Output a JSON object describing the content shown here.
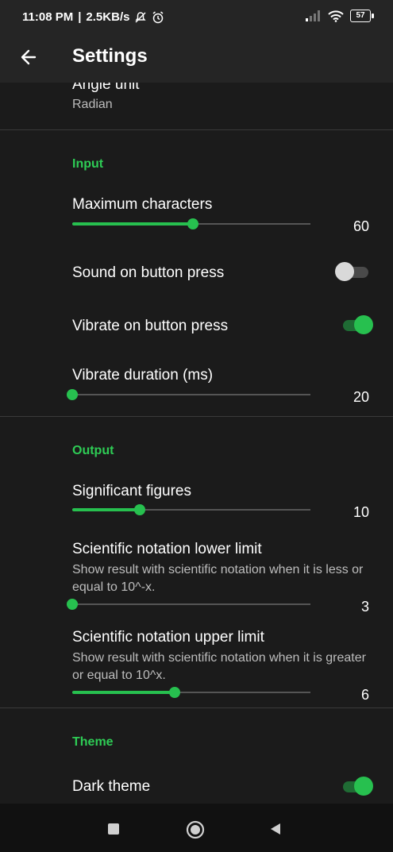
{
  "status": {
    "time": "11:08 PM",
    "speed": "2.5KB/s",
    "battery": "57"
  },
  "appbar": {
    "title": "Settings"
  },
  "angle": {
    "title": "Angle unit",
    "value": "Radian"
  },
  "input": {
    "header": "Input",
    "max_chars": {
      "title": "Maximum characters",
      "value": "60",
      "fraction": 0.505
    },
    "sound": {
      "title": "Sound on button press",
      "enabled": false
    },
    "vibrate": {
      "title": "Vibrate on button press",
      "enabled": true
    },
    "vibrate_duration": {
      "title": "Vibrate duration (ms)",
      "value": "20",
      "fraction": 0.0
    }
  },
  "output": {
    "header": "Output",
    "sig_figs": {
      "title": "Significant figures",
      "value": "10",
      "fraction": 0.285
    },
    "sci_lower": {
      "title": "Scientific notation lower limit",
      "desc": "Show result with scientific notation when it is less or equal to 10^-x.",
      "value": "3",
      "fraction": 0.0
    },
    "sci_upper": {
      "title": "Scientific notation upper limit",
      "desc": "Show result with scientific notation when it is greater or equal to 10^x.",
      "value": "6",
      "fraction": 0.43
    }
  },
  "theme": {
    "header": "Theme",
    "dark": {
      "title": "Dark theme",
      "enabled": true
    }
  },
  "colors": {
    "accent": "#27c04f",
    "background": "#1b1b1b",
    "bar": "#252525"
  },
  "icons": {
    "back": "arrow-left-icon",
    "nav_recent": "square-icon",
    "nav_home": "circle-icon",
    "nav_back": "triangle-icon"
  }
}
